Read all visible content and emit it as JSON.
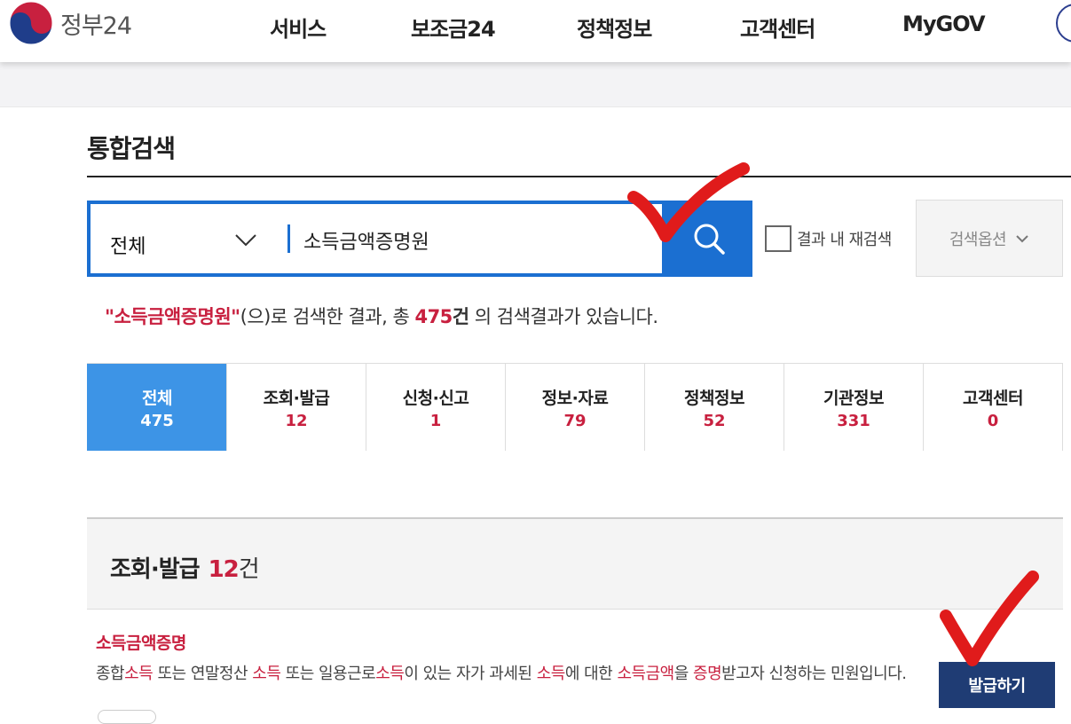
{
  "header": {
    "logo_text": "정부24",
    "nav": [
      "서비스",
      "보조금24",
      "정책정보",
      "고객센터",
      "MyGOV"
    ]
  },
  "page": {
    "title": "통합검색"
  },
  "search": {
    "category": "전체",
    "query": "소득금액증명원",
    "recheck_label": "결과 내 재검색",
    "options_label": "검색옵션"
  },
  "result": {
    "keyword_quoted": "\"소득금액증명원\"",
    "mid_text": "(으)로 검색한 결과, 총 ",
    "total": "475",
    "unit": "건",
    "tail_text": " 의 검색결과가 있습니다."
  },
  "tabs": [
    {
      "label": "전체",
      "count": "475",
      "active": true
    },
    {
      "label": "조회·발급",
      "count": "12",
      "active": false
    },
    {
      "label": "신청·신고",
      "count": "1",
      "active": false
    },
    {
      "label": "정보·자료",
      "count": "79",
      "active": false
    },
    {
      "label": "정책정보",
      "count": "52",
      "active": false
    },
    {
      "label": "기관정보",
      "count": "331",
      "active": false
    },
    {
      "label": "고객센터",
      "count": "0",
      "active": false
    }
  ],
  "section": {
    "title": "조회·발급",
    "count": "12",
    "unit": "건"
  },
  "item": {
    "title": "소득금액증명",
    "desc_parts": [
      {
        "t": "종합",
        "hl": false
      },
      {
        "t": "소득",
        "hl": true
      },
      {
        "t": " 또는 연말정산 ",
        "hl": false
      },
      {
        "t": "소득",
        "hl": true
      },
      {
        "t": " 또는 일용근로",
        "hl": false
      },
      {
        "t": "소득",
        "hl": true
      },
      {
        "t": "이 있는 자가 과세된 ",
        "hl": false
      },
      {
        "t": "소득",
        "hl": true
      },
      {
        "t": "에 대한 ",
        "hl": false
      },
      {
        "t": "소득금액",
        "hl": true
      },
      {
        "t": "을 ",
        "hl": false
      },
      {
        "t": "증명",
        "hl": true
      },
      {
        "t": "받고자 신청하는 민원입니다.",
        "hl": false
      }
    ],
    "button_label": "발급하기"
  },
  "colors": {
    "primary_blue": "#1b6fd1",
    "active_tab": "#3d94e6",
    "accent_red": "#c8203f",
    "issue_button": "#1f3c74",
    "annotation_red": "#e01b1b"
  }
}
